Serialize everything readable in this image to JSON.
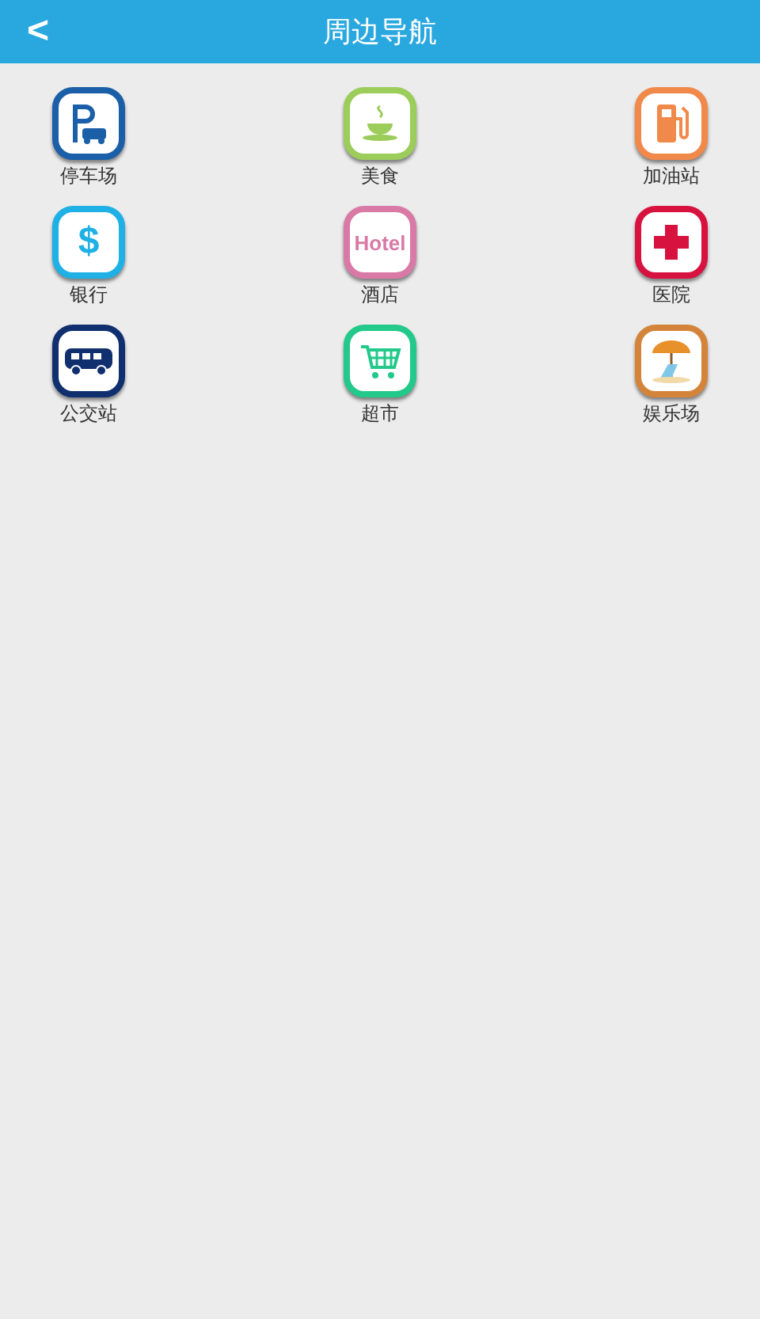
{
  "header": {
    "back": "<",
    "title": "周边导航"
  },
  "items": [
    {
      "label": "停车场",
      "kind": "parking",
      "color": "#1a5fa8"
    },
    {
      "label": "美食",
      "kind": "food",
      "color": "#9ccc5a"
    },
    {
      "label": "加油站",
      "kind": "fuel",
      "color": "#f0894a"
    },
    {
      "label": "银行",
      "kind": "bank",
      "color": "#1fb0e6",
      "glyph": "$"
    },
    {
      "label": "酒店",
      "kind": "hotel",
      "color": "#d97aa6",
      "glyph": "Hotel"
    },
    {
      "label": "医院",
      "kind": "hospital",
      "color": "#d8123e"
    },
    {
      "label": "公交站",
      "kind": "bus",
      "color": "#0f2f6e"
    },
    {
      "label": "超市",
      "kind": "market",
      "color": "#22c98a"
    },
    {
      "label": "娱乐场",
      "kind": "beach",
      "color": "#d4843a"
    }
  ]
}
